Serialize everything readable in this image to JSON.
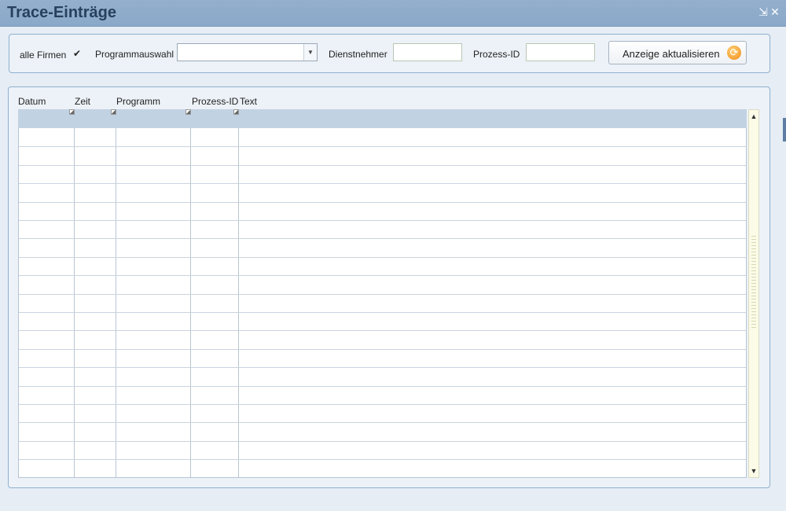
{
  "window": {
    "title": "Trace-Einträge",
    "minimize_glyph": "⇲",
    "close_glyph": "✕"
  },
  "filters": {
    "all_companies_label": "alle Firmen",
    "all_companies_checked": true,
    "check_glyph": "✔",
    "program_label": "Programmauswahl",
    "program_value": "",
    "employee_label": "Dienstnehmer",
    "employee_value": "",
    "process_id_label": "Prozess-ID",
    "process_id_value": "",
    "refresh_label": "Anzeige aktualisieren",
    "refresh_icon": "refresh-icon"
  },
  "table": {
    "columns": [
      "Datum",
      "Zeit",
      "Programm",
      "Prozess-ID",
      "Text"
    ],
    "rows": []
  },
  "colors": {
    "titlebar": "#8aa8c8",
    "title_text": "#27405e",
    "panel_border": "#8fb0cf",
    "header_row": "#c1d2e3"
  }
}
